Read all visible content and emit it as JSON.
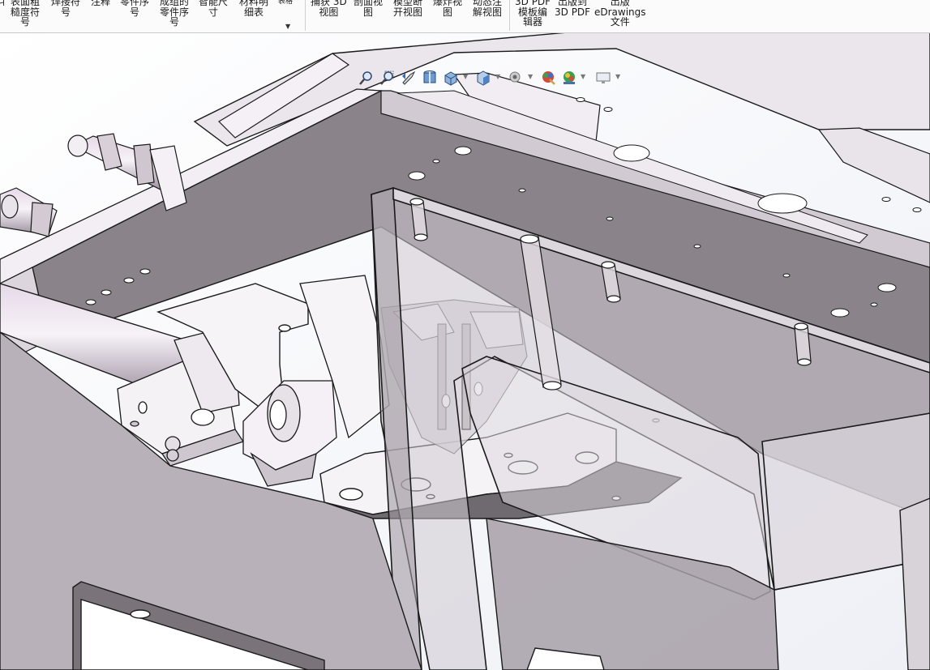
{
  "ribbon": {
    "items": [
      {
        "label": "ㄐ"
      },
      {
        "label": "表面粗\n糙度符\n号"
      },
      {
        "label": "焊接符\n号"
      },
      {
        "label": "注释"
      },
      {
        "label": "零件序\n号"
      },
      {
        "label": "成组的\n零件序\n号"
      },
      {
        "label": "智能尺\n寸"
      },
      {
        "label": "材料明\n细表"
      },
      {
        "label": "表格"
      },
      {
        "label": "捕获 3D\n视图"
      },
      {
        "label": "剖面视\n图"
      },
      {
        "label": "模型断\n开视图"
      },
      {
        "label": "爆炸视\n图"
      },
      {
        "label": "动态注\n解视图"
      },
      {
        "label": "3D PDF\n模板编\n辑器"
      },
      {
        "label": "出版到\n3D PDF"
      },
      {
        "label": "出版\neDrawings\n文件"
      }
    ]
  },
  "heads_up_toolbar": {
    "buttons": [
      {
        "icon": "zoom-to-fit-icon"
      },
      {
        "icon": "zoom-to-area-icon"
      },
      {
        "icon": "previous-view-icon"
      },
      {
        "icon": "section-view-icon"
      },
      {
        "icon": "view-orientation-icon"
      },
      {
        "icon": "display-style-icon"
      },
      {
        "icon": "hide-show-items-icon"
      },
      {
        "icon": "edit-appearance-icon"
      },
      {
        "icon": "apply-scene-icon"
      },
      {
        "icon": "view-settings-icon"
      }
    ]
  },
  "colors": {
    "part_light": "#efeaf0",
    "part_mid": "#cbc3cb",
    "part_dark": "#7d767c",
    "edge": "#1a1a1a",
    "glass": "#d6d1d8",
    "background": "#ffffff"
  }
}
